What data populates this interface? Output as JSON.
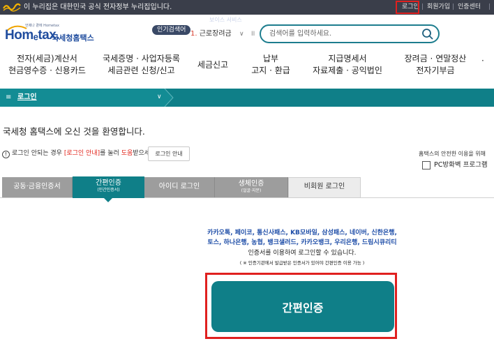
{
  "gov_bar": {
    "text": "이 누리집은 대한민국 공식 전자정부 누리집입니다.",
    "utility": {
      "login": "로그인",
      "signup": "회원가입",
      "cert_center": "인증센터"
    },
    "sep": "|"
  },
  "header": {
    "logo_sub": "언제나 곁에 Hometax",
    "logo_main": "Homₑtax.",
    "logo_kr": "국세청홈택스",
    "ghost_tip": "보이스 서비스",
    "popular_badge": "인기검색어",
    "keyword": {
      "rank": "1.",
      "text": "근로장려금",
      "chevron": "∨",
      "pause": "II"
    },
    "search": {
      "placeholder": "검색어를 입력하세요.",
      "icon": "search-icon"
    }
  },
  "nav": {
    "items": [
      {
        "line1": "전자(세금)계산서",
        "line2": "현금영수증 · 신용카드"
      },
      {
        "line1": "국세증명 · 사업자등록",
        "line2": "세금관련 신청/신고"
      },
      {
        "line1": "세금신고",
        "line2": ""
      },
      {
        "line1": "납부",
        "line2": "고지 · 환급"
      },
      {
        "line1": "지급명세서",
        "line2": "자료제출 · 공익법인"
      },
      {
        "line1": "장려금 · 연말정산",
        "line2": "전자기부금"
      }
    ],
    "more": "·"
  },
  "location": {
    "menu_icon": "≡",
    "title": "로그인",
    "chevron": "∨"
  },
  "welcome": "국세청 홈택스에 오신 것을 환영합니다.",
  "help": {
    "icon": "!",
    "p1": "로그인 안되는 경우 ",
    "em1": "[로그인 안내]",
    "p2": "를 눌러 ",
    "em2": "도움",
    "p3": "받으세요.",
    "button": "로그인 안내"
  },
  "safety": {
    "text": "홈택스의 안전한 이용을 위해",
    "checkbox_label": "PC방화벽 프로그램"
  },
  "tabs": [
    {
      "label": "공동·금융인증서",
      "sub": ""
    },
    {
      "label": "간편인증",
      "sub": "(민간인증서)"
    },
    {
      "label": "아이디 로그인",
      "sub": ""
    },
    {
      "label": "생체인증",
      "sub": "(얼굴·지문)"
    },
    {
      "label": "비회원 로그인",
      "sub": ""
    }
  ],
  "simple_auth": {
    "providers_1": "카카오톡, 페이코, 통신사패스, KB모바일, 삼성패스, 네이버, 신한은행,",
    "providers_2": "토스, 하나은행, 농협, 뱅크샐러드, 카카오뱅크, 우리은행, 드림시큐리티",
    "desc": "인증서를 이용하여 로그인할 수 있습니다.",
    "note": "( ※ 인증기관에서 발급받은 인증서가 있어야 간편인증 이용 가능 )",
    "button": "간편인증"
  },
  "colors": {
    "teal": "#0f7f88",
    "navy": "#1f4c9e",
    "highlight": "#e0201f",
    "top_bar": "#3a3e4a"
  }
}
